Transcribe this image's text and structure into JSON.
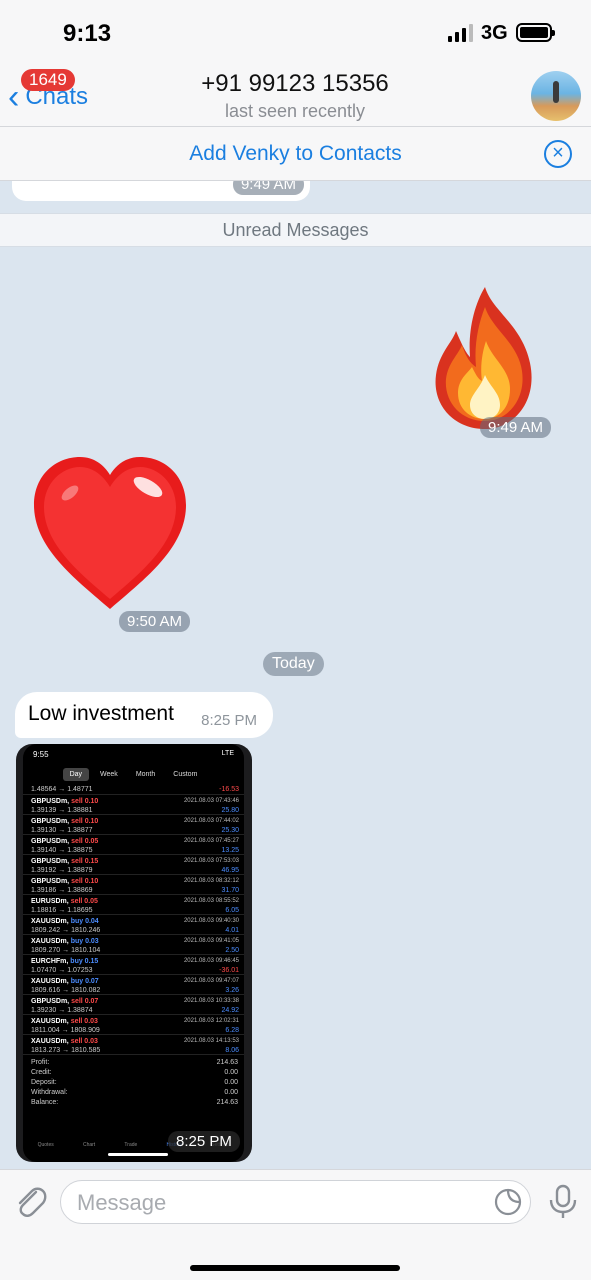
{
  "status": {
    "time": "9:13",
    "network": "3G"
  },
  "header": {
    "back_label": "Chats",
    "unread_badge": "1649",
    "peer_name": "+91 99123 15356",
    "peer_status": "last seen recently"
  },
  "add_contact": {
    "label": "Add Venky to Contacts"
  },
  "chat": {
    "cut_time": "9:49 AM",
    "unread_label": "Unread Messages",
    "fire_time": "9:49 AM",
    "heart_time": "9:50 AM",
    "date_separator": "Today",
    "text_message": {
      "text": "Low investment",
      "time": "8:25 PM"
    },
    "photo_time": "8:25 PM",
    "screenshot": {
      "time": "9:55",
      "signal": "LTE",
      "tabs": [
        "Day",
        "Week",
        "Month",
        "Custom"
      ],
      "partial_row": {
        "price": "1.48564 → 1.48771",
        "pl": "-16.53"
      },
      "deals": [
        {
          "symbol": "GBPUSDm,",
          "side": "sell 0.10",
          "dir": "sell",
          "date": "2021.08.03 07:43:46",
          "price": "1.39139 → 1.38881",
          "pl": "25.80"
        },
        {
          "symbol": "GBPUSDm,",
          "side": "sell 0.10",
          "dir": "sell",
          "date": "2021.08.03 07:44:02",
          "price": "1.39130 → 1.38877",
          "pl": "25.30"
        },
        {
          "symbol": "GBPUSDm,",
          "side": "sell 0.05",
          "dir": "sell",
          "date": "2021.08.03 07:45:27",
          "price": "1.39140 → 1.38875",
          "pl": "13.25"
        },
        {
          "symbol": "GBPUSDm,",
          "side": "sell 0.15",
          "dir": "sell",
          "date": "2021.08.03 07:53:03",
          "price": "1.39192 → 1.38879",
          "pl": "46.95"
        },
        {
          "symbol": "GBPUSDm,",
          "side": "sell 0.10",
          "dir": "sell",
          "date": "2021.08.03 08:32:12",
          "price": "1.39186 → 1.38869",
          "pl": "31.70"
        },
        {
          "symbol": "EURUSDm,",
          "side": "sell 0.05",
          "dir": "sell",
          "date": "2021.08.03 08:55:52",
          "price": "1.18816 → 1.18695",
          "pl": "6.05"
        },
        {
          "symbol": "XAUUSDm,",
          "side": "buy 0.04",
          "dir": "buy",
          "date": "2021.08.03 09:40:30",
          "price": "1809.242 → 1810.246",
          "pl": "4.01"
        },
        {
          "symbol": "XAUUSDm,",
          "side": "buy 0.03",
          "dir": "buy",
          "date": "2021.08.03 09:41:05",
          "price": "1809.270 → 1810.104",
          "pl": "2.50"
        },
        {
          "symbol": "EURCHFm,",
          "side": "buy 0.15",
          "dir": "buy",
          "date": "2021.08.03 09:46:45",
          "price": "1.07470 → 1.07253",
          "pl": "-36.01"
        },
        {
          "symbol": "XAUUSDm,",
          "side": "buy 0.07",
          "dir": "buy",
          "date": "2021.08.03 09:47:07",
          "price": "1809.616 → 1810.082",
          "pl": "3.26"
        },
        {
          "symbol": "GBPUSDm,",
          "side": "sell 0.07",
          "dir": "sell",
          "date": "2021.08.03 10:33:38",
          "price": "1.39230 → 1.38874",
          "pl": "24.92"
        },
        {
          "symbol": "XAUUSDm,",
          "side": "sell 0.03",
          "dir": "sell",
          "date": "2021.08.03 12:02:31",
          "price": "1811.004 → 1808.909",
          "pl": "6.28"
        },
        {
          "symbol": "XAUUSDm,",
          "side": "sell 0.03",
          "dir": "sell",
          "date": "2021.08.03 14:13:53",
          "price": "1813.273 → 1810.585",
          "pl": "8.06"
        }
      ],
      "totals": [
        {
          "label": "Profit:",
          "value": "214.63"
        },
        {
          "label": "Credit:",
          "value": "0.00"
        },
        {
          "label": "Deposit:",
          "value": "0.00"
        },
        {
          "label": "Withdrawal:",
          "value": "0.00"
        },
        {
          "label": "Balance:",
          "value": "214.63"
        }
      ],
      "bottom_tabs": [
        "Quotes",
        "Chart",
        "Trade",
        "History",
        "Settings"
      ]
    }
  },
  "input": {
    "placeholder": "Message"
  },
  "colors": {
    "accent": "#1b7fe0",
    "badge": "#e53935",
    "chat_bg": "#dbe5ef"
  }
}
